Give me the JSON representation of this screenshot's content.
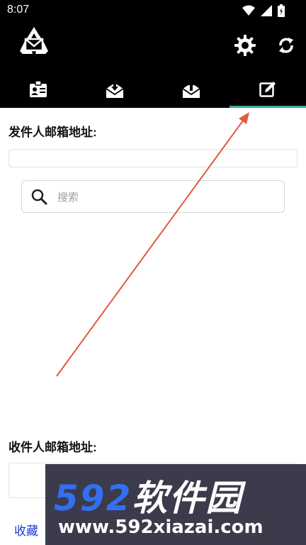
{
  "status": {
    "time": "8:07"
  },
  "labels": {
    "sender": "发件人邮箱地址:",
    "receiver": "收件人邮箱地址:"
  },
  "search": {
    "placeholder": "搜索"
  },
  "favorites": {
    "label": "收藏"
  },
  "watermark": {
    "brand_digits": "592",
    "brand_text": "软件园",
    "url": "www.592xiazai.com"
  },
  "colors": {
    "accent": "#3aa99f",
    "annotation_arrow": "#e05a3c",
    "link": "#1a3bd1"
  },
  "tabs": [
    {
      "icon": "contact-card-icon",
      "active": false
    },
    {
      "icon": "inbox-download-icon",
      "active": false
    },
    {
      "icon": "outbox-upload-icon",
      "active": false
    },
    {
      "icon": "compose-icon",
      "active": true
    }
  ]
}
